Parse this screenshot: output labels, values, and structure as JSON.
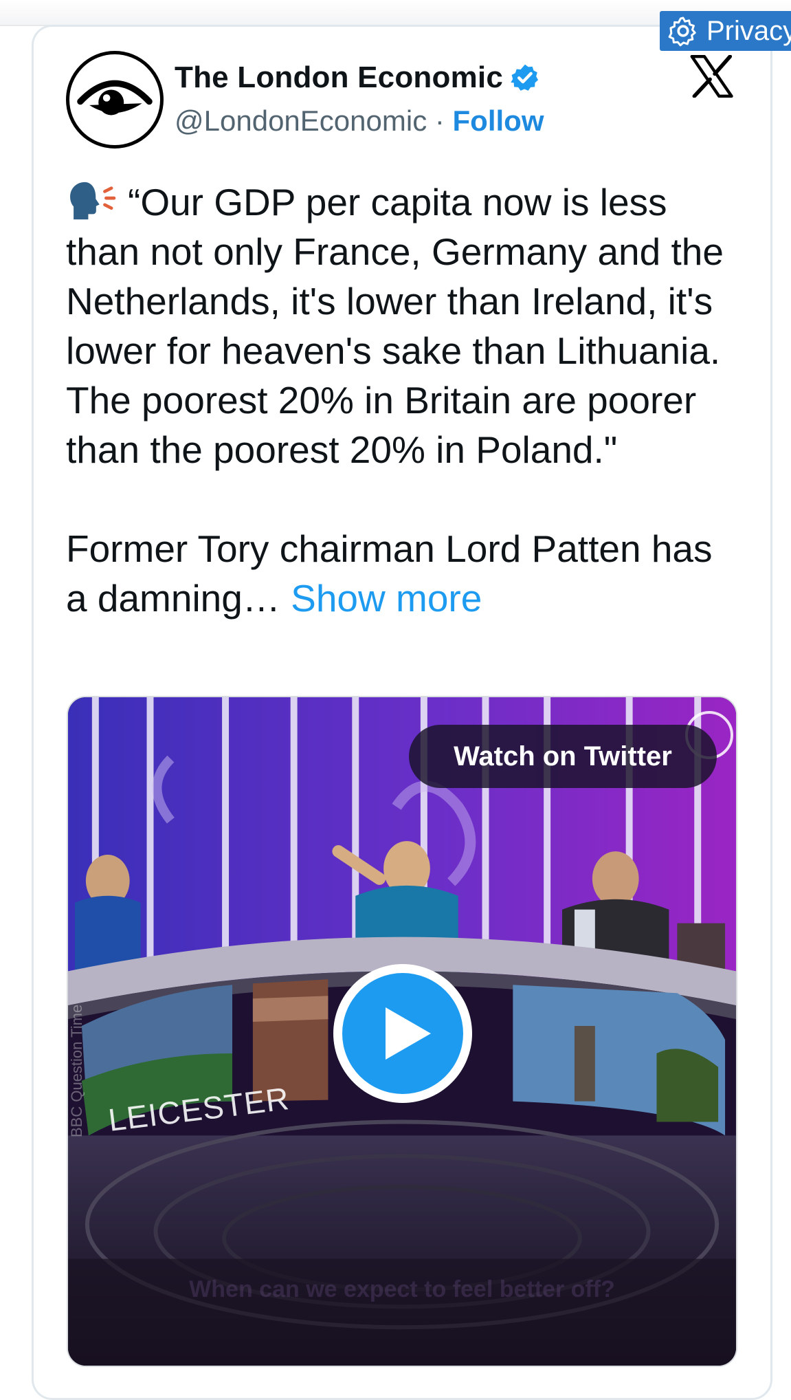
{
  "privacy": {
    "label": "Privacy"
  },
  "author": {
    "name": "The London Economic",
    "handle": "@LondonEconomic",
    "separator": " · ",
    "follow_label": "Follow"
  },
  "tweet": {
    "paragraph1": "“Our GDP per capita now is less than not only France, Germany and the Netherlands, it's lower than Ireland, it's lower for heaven's sake than Lithuania. The poorest 20% in Britain are poorer than the poorest 20% in Poland.\"",
    "paragraph2": "Former Tory chairman Lord Patten has a damning…",
    "show_more": "Show more"
  },
  "media": {
    "watch_label": "Watch on Twitter",
    "watermark": "BBC Question Time",
    "sign_text": "LEICESTER",
    "caption": "When can we expect to feel better off?"
  },
  "icons": {
    "privacy": "gear-icon",
    "avatar": "eye-logo",
    "verified": "verified-badge-icon",
    "brand": "x-logo-icon",
    "speaking": "speaking-head-icon",
    "play": "play-icon"
  },
  "colors": {
    "link": "#1d9bf0",
    "follow": "#1d8ae0",
    "text": "#0f1419",
    "secondary": "#536471",
    "privacy_bg": "#2b78c8"
  }
}
